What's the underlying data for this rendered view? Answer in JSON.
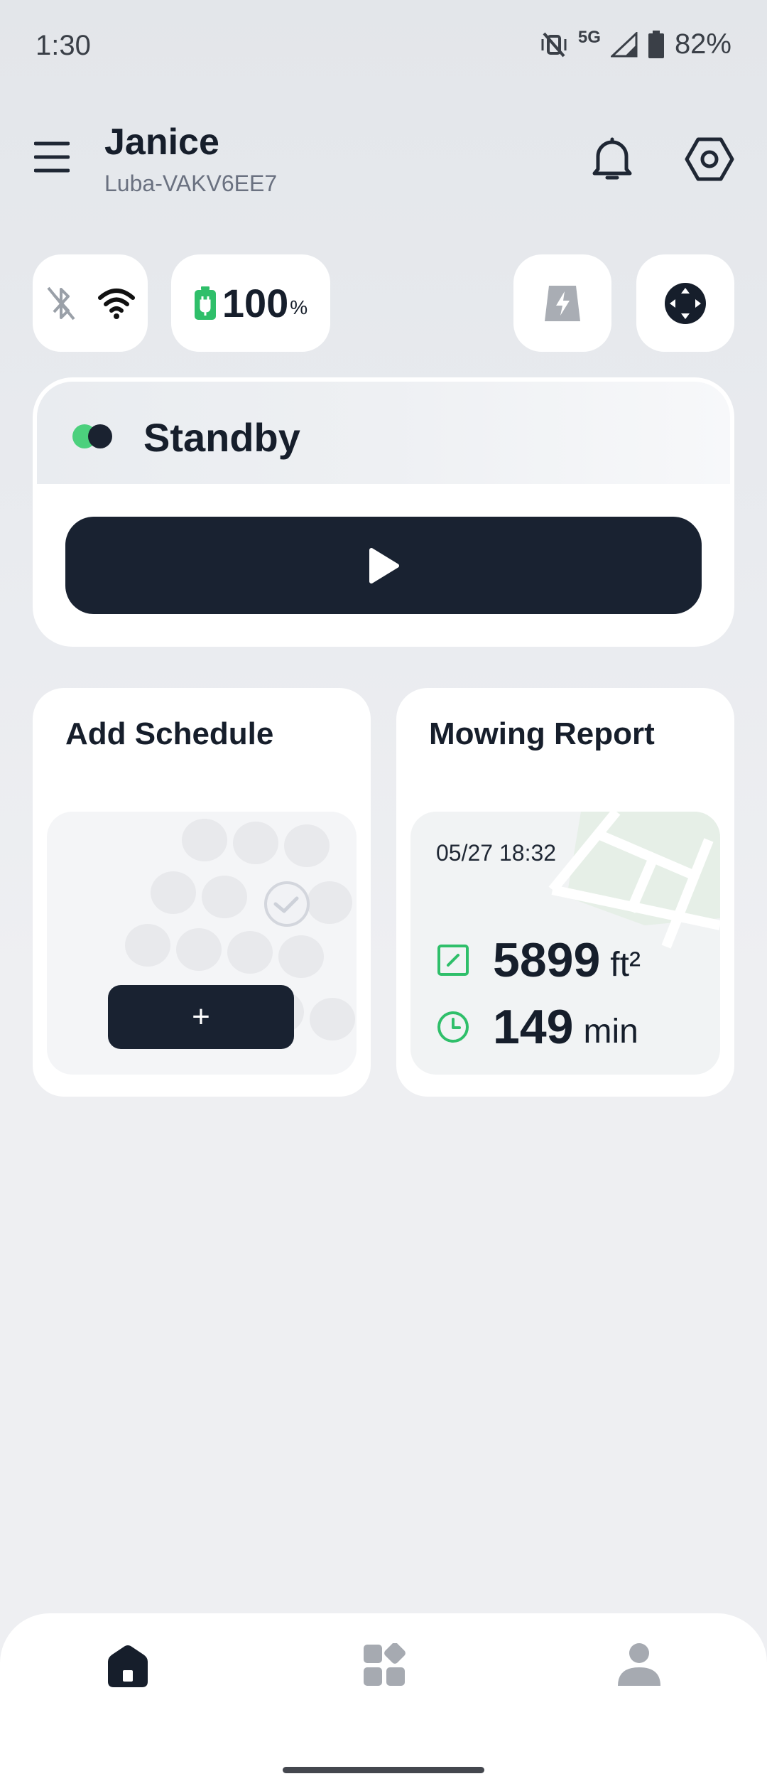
{
  "status_bar": {
    "time": "1:30",
    "network": "5G",
    "battery": "82%"
  },
  "header": {
    "user_name": "Janice",
    "device_name": "Luba-VAKV6EE7"
  },
  "chips": {
    "battery_value": "100",
    "battery_unit": "%"
  },
  "status_card": {
    "state": "Standby"
  },
  "schedule_card": {
    "title": "Add Schedule",
    "add_label": "+"
  },
  "report_card": {
    "title": "Mowing Report",
    "date": "05/27 18:32",
    "area_value": "5899",
    "area_unit": "ft²",
    "time_value": "149",
    "time_unit": "min"
  },
  "colors": {
    "accent_green": "#4cd07d",
    "dark": "#192231",
    "icon_green": "#2fbf6a"
  }
}
